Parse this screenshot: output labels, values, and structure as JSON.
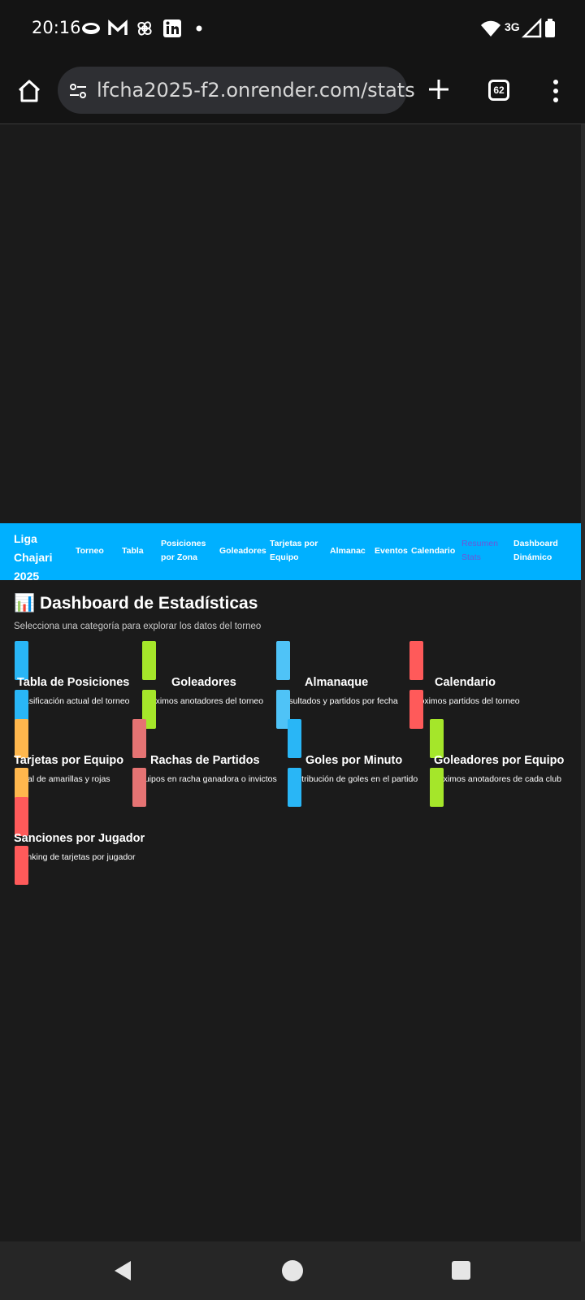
{
  "status": {
    "time": "20:16",
    "network": "3G"
  },
  "browser": {
    "url": "lfcha2025-f2.onrender.com/stats",
    "tab_count": "62"
  },
  "nav": {
    "brand": "Liga Chajari 2025",
    "links": [
      "Torneo",
      "Tabla",
      "Posiciones por Zona",
      "Goleadores",
      "Tarjetas por Equipo",
      "Almanac",
      "Eventos",
      "Calendario",
      "Resumen Stats",
      "Dashboard Dinámico"
    ],
    "active": "Resumen Stats"
  },
  "dashboard": {
    "title": "📊 Dashboard de Estadísticas",
    "subtitle": "Selecciona una categoría para explorar los datos del torneo",
    "cards": [
      {
        "title": "Tabla de Posiciones",
        "desc": "Clasificación actual del torneo",
        "color": "#29b6f6"
      },
      {
        "title": "Goleadores",
        "desc": "Máximos anotadores del torneo",
        "color": "#a5e62a"
      },
      {
        "title": "Almanaque",
        "desc": "Resultados y partidos por fecha",
        "color": "#4fc3f7"
      },
      {
        "title": "Calendario",
        "desc": "Próximos partidos del torneo",
        "color": "#ff5a5a"
      },
      {
        "title": "Tarjetas por Equipo",
        "desc": "Total de amarillas y rojas",
        "color": "#ffb74d"
      },
      {
        "title": "Rachas de Partidos",
        "desc": "Equipos en racha ganadora o invictos",
        "color": "#e57373"
      },
      {
        "title": "Goles por Minuto",
        "desc": "Distribución de goles en el partido",
        "color": "#29b6f6"
      },
      {
        "title": "Goleadores por Equipo",
        "desc": "Máximos anotadores de cada club",
        "color": "#a5e62a"
      },
      {
        "title": "Sanciones por Jugador",
        "desc": "Ranking de tarjetas por jugador",
        "color": "#ff5a5a"
      }
    ]
  }
}
